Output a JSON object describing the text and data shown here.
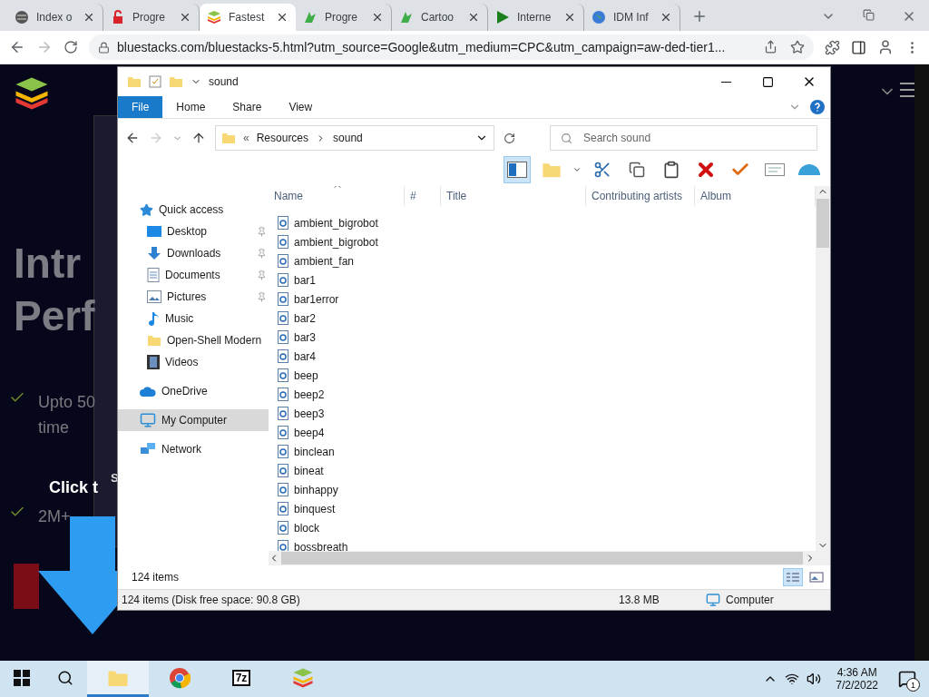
{
  "browser": {
    "tabs": [
      {
        "title": "Index o",
        "kind": "globe",
        "selected": false
      },
      {
        "title": "Progre",
        "kind": "lock",
        "selected": false
      },
      {
        "title": "Fastest",
        "kind": "stack",
        "selected": true
      },
      {
        "title": "Progre",
        "kind": "leaf",
        "selected": false
      },
      {
        "title": "Cartoo",
        "kind": "leaf",
        "selected": false
      },
      {
        "title": "Interne",
        "kind": "play",
        "selected": false
      },
      {
        "title": "IDM Inf",
        "kind": "earth",
        "selected": false
      }
    ],
    "url": "bluestacks.com/bluestacks-5.html?utm_source=Google&utm_medium=CPC&utm_campaign=aw-ded-tier1..."
  },
  "page": {
    "heading": [
      "Intr",
      "Perf"
    ],
    "features": [
      {
        "lines": [
          "Upto 50",
          "time"
        ]
      },
      {
        "lines": [
          "2M+"
        ]
      }
    ],
    "overlay_text": "Click t",
    "dialog_letters": [
      "S"
    ]
  },
  "explorer": {
    "title": "sound",
    "ribbon_tabs": [
      {
        "label": "File",
        "selected": true
      },
      {
        "label": "Home",
        "selected": false
      },
      {
        "label": "Share",
        "selected": false
      },
      {
        "label": "View",
        "selected": false
      }
    ],
    "breadcrumb_overflow": "«",
    "breadcrumb": [
      "Resources",
      "sound"
    ],
    "search": {
      "placeholder": "Search sound"
    },
    "columns": [
      "Name",
      "#",
      "Title",
      "Contributing artists",
      "Album"
    ],
    "nav": [
      {
        "label": "Quick access",
        "kind": "star",
        "selected": false,
        "children": [
          {
            "label": "Desktop",
            "kind": "desktop",
            "pinned": true,
            "selected": false
          },
          {
            "label": "Downloads",
            "kind": "download",
            "pinned": true,
            "selected": false
          },
          {
            "label": "Documents",
            "kind": "document",
            "pinned": true,
            "selected": false
          },
          {
            "label": "Pictures",
            "kind": "pictures",
            "pinned": true,
            "selected": false
          },
          {
            "label": "Music",
            "kind": "music",
            "pinned": false,
            "selected": false
          },
          {
            "label": "Open-Shell Modern",
            "kind": "folder",
            "pinned": false,
            "selected": false
          },
          {
            "label": "Videos",
            "kind": "film",
            "pinned": false,
            "selected": false
          }
        ]
      },
      {
        "label": "OneDrive",
        "kind": "cloud",
        "selected": false
      },
      {
        "label": "My Computer",
        "kind": "computer",
        "selected": true
      },
      {
        "label": "Network",
        "kind": "network",
        "selected": false
      }
    ],
    "files": [
      "ambient_bigrobot",
      "ambient_bigrobot",
      "ambient_fan",
      "bar1",
      "bar1error",
      "bar2",
      "bar3",
      "bar4",
      "beep",
      "beep2",
      "beep3",
      "beep4",
      "binclean",
      "bineat",
      "binhappy",
      "binquest",
      "block",
      "bossbreath"
    ],
    "item_count": "124 items",
    "status": {
      "left": "124 items (Disk free space: 90.8 GB)",
      "size": "13.8 MB",
      "location": "Computer"
    }
  },
  "taskbar": {
    "apps": [
      {
        "kind": "explorer",
        "selected": true
      },
      {
        "kind": "chrome",
        "selected": false
      },
      {
        "kind": "sevenzip",
        "label": "7z",
        "selected": false
      },
      {
        "kind": "bluestacks",
        "selected": false
      }
    ],
    "time": "4:36 AM",
    "date": "7/2/2022",
    "notifications": "1"
  }
}
